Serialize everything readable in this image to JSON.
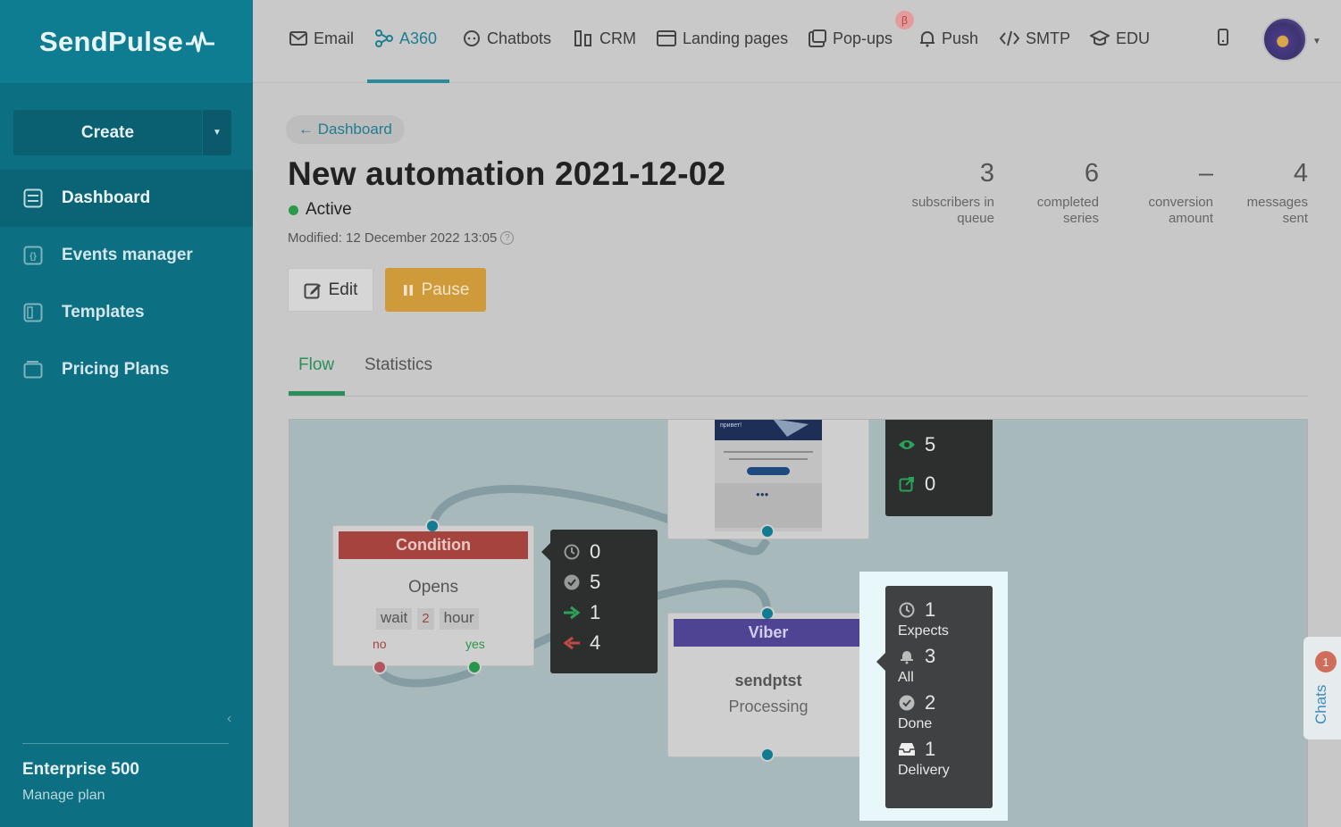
{
  "app": {
    "logo_text": "SendPulse",
    "accent_color": "#0c6f82"
  },
  "sidebar": {
    "create_label": "Create",
    "items": [
      {
        "label": "Dashboard",
        "icon": "dashboard-icon",
        "active": true
      },
      {
        "label": "Events manager",
        "icon": "events-icon",
        "active": false
      },
      {
        "label": "Templates",
        "icon": "templates-icon",
        "active": false
      },
      {
        "label": "Pricing Plans",
        "icon": "wallet-icon",
        "active": false
      }
    ],
    "plan_name": "Enterprise 500",
    "manage_plan": "Manage plan"
  },
  "topnav": {
    "items": [
      {
        "label": "Email",
        "icon": "mail-icon"
      },
      {
        "label": "A360",
        "icon": "automation-icon",
        "active": true
      },
      {
        "label": "Chatbots",
        "icon": "chatbot-icon"
      },
      {
        "label": "CRM",
        "icon": "crm-icon"
      },
      {
        "label": "Landing pages",
        "icon": "landing-icon"
      },
      {
        "label": "Pop-ups",
        "icon": "popup-icon"
      },
      {
        "label": "Push",
        "icon": "bell-icon"
      },
      {
        "label": "SMTP",
        "icon": "code-icon"
      },
      {
        "label": "EDU",
        "icon": "graduation-icon"
      }
    ],
    "beta_badge": "β"
  },
  "page": {
    "back_label": "← Dashboard",
    "title": "New automation 2021-12-02",
    "status": "Active",
    "modified": "Modified: 12 December 2022 13:05",
    "edit_label": "Edit",
    "pause_label": "Pause",
    "stats": [
      {
        "value": "3",
        "label_1": "subscribers in",
        "label_2": "queue"
      },
      {
        "value": "6",
        "label_1": "completed",
        "label_2": "series"
      },
      {
        "value": "–",
        "label_1": "conversion",
        "label_2": "amount"
      },
      {
        "value": "4",
        "label_1": "messages",
        "label_2": "sent"
      }
    ],
    "tabs": [
      "Flow",
      "Statistics"
    ]
  },
  "flow": {
    "email_tooltip": {
      "opens": "5",
      "clicks": "0"
    },
    "email_preview_text": "привет!",
    "condition": {
      "title": "Condition",
      "event": "Opens",
      "wait_label": "wait",
      "wait_value": "2",
      "wait_unit": "hour",
      "no_label": "no",
      "yes_label": "yes"
    },
    "condition_tooltip": {
      "waiting": "0",
      "done": "5",
      "yes": "1",
      "no": "4"
    },
    "viber": {
      "title": "Viber",
      "name": "sendptst",
      "status": "Processing"
    },
    "viber_tooltip": {
      "expects_value": "1",
      "expects_label": "Expects",
      "all_value": "3",
      "all_label": "All",
      "done_value": "2",
      "done_label": "Done",
      "delivery_value": "1",
      "delivery_label": "Delivery"
    }
  },
  "chats": {
    "label": "Chats",
    "badge": "1"
  }
}
